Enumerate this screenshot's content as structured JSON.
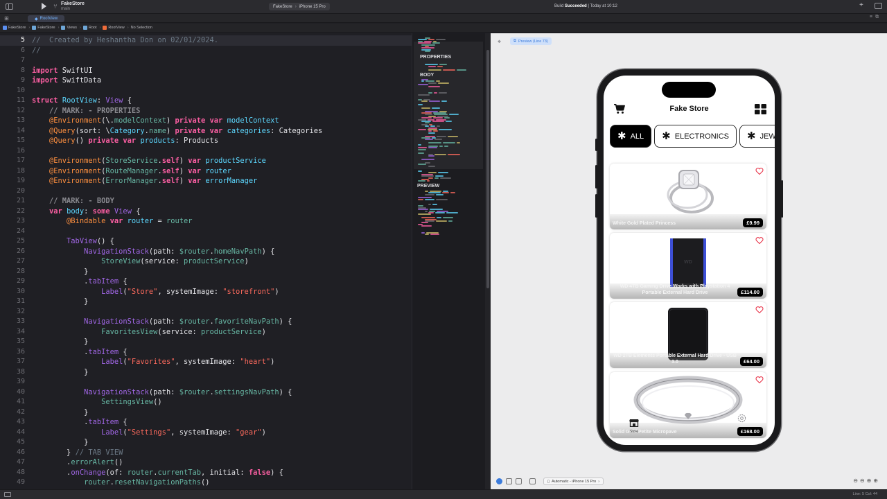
{
  "titlebar": {
    "project": "FakeStore",
    "branch": "main",
    "scheme_project": "FakeStore",
    "scheme_device": "iPhone 15 Pro",
    "build_prefix": "Build",
    "build_state": "Succeeded",
    "build_time": "| Today at 10:12"
  },
  "tab": {
    "label": "RootView"
  },
  "breadcrumbs": [
    "FakeStore",
    "FakeStore",
    "Views",
    "Root",
    "RootView",
    "No Selection"
  ],
  "minimap": {
    "properties": "PROPERTIES",
    "body": "BODY",
    "preview": "PREVIEW"
  },
  "editor": {
    "lines": [
      {
        "n": "5",
        "html": "<span class=\"c\">//  Created by Heshantha Don on 02/01/2024.</span>"
      },
      {
        "n": "6",
        "html": "<span class=\"c\">//</span>"
      },
      {
        "n": "7",
        "html": ""
      },
      {
        "n": "8",
        "html": "<span class=\"k\">import</span> SwiftUI"
      },
      {
        "n": "9",
        "html": "<span class=\"k\">import</span> SwiftData"
      },
      {
        "n": "10",
        "html": ""
      },
      {
        "n": "11",
        "html": "<span class=\"k\">struct</span> <span class=\"t\">RootView</span>: <span class=\"fm\">View</span> {"
      },
      {
        "n": "12",
        "html": "    <span class=\"cm\">// MARK: - PROPERTIES</span>"
      },
      {
        "n": "13",
        "html": "    <span class=\"at\">@Environment</span>(\\.<span class=\"f\">modelContext</span>) <span class=\"k\">private</span> <span class=\"k\">var</span> <span class=\"t\">modelContext</span>"
      },
      {
        "n": "14",
        "html": "    <span class=\"at\">@Query</span>(sort: \\<span class=\"t\">Category</span>.<span class=\"f\">name</span>) <span class=\"k\">private</span> <span class=\"k\">var</span> <span class=\"t\">categories</span>: Categories"
      },
      {
        "n": "15",
        "html": "    <span class=\"at\">@Query</span>() <span class=\"k\">private</span> <span class=\"k\">var</span> <span class=\"t\">products</span>: Products"
      },
      {
        "n": "16",
        "html": ""
      },
      {
        "n": "17",
        "html": "    <span class=\"at\">@Environment</span>(<span class=\"f\">StoreService</span>.<span class=\"k\">self</span>) <span class=\"k\">var</span> <span class=\"t\">productService</span>"
      },
      {
        "n": "18",
        "html": "    <span class=\"at\">@Environment</span>(<span class=\"f\">RouteManager</span>.<span class=\"k\">self</span>) <span class=\"k\">var</span> <span class=\"t\">router</span>"
      },
      {
        "n": "19",
        "html": "    <span class=\"at\">@Environment</span>(<span class=\"f\">ErrorManager</span>.<span class=\"k\">self</span>) <span class=\"k\">var</span> <span class=\"t\">errorManager</span>"
      },
      {
        "n": "20",
        "html": ""
      },
      {
        "n": "21",
        "html": "    <span class=\"cm\">// MARK: - BODY</span>"
      },
      {
        "n": "22",
        "html": "    <span class=\"k\">var</span> <span class=\"t\">body</span>: <span class=\"k\">some</span> <span class=\"fm\">View</span> {"
      },
      {
        "n": "23",
        "html": "        <span class=\"at\">@Bindable</span> <span class=\"k\">var</span> <span class=\"t\">router</span> = <span class=\"f\">router</span>"
      },
      {
        "n": "24",
        "html": ""
      },
      {
        "n": "25",
        "html": "        <span class=\"fm\">TabView</span>() {"
      },
      {
        "n": "26",
        "html": "            <span class=\"fm\">NavigationStack</span>(path: <span class=\"f\">$router</span>.<span class=\"f\">homeNavPath</span>) {"
      },
      {
        "n": "27",
        "html": "                <span class=\"f\">StoreView</span>(service: <span class=\"f\">productService</span>)"
      },
      {
        "n": "28",
        "html": "            }"
      },
      {
        "n": "29",
        "html": "            .<span class=\"fm\">tabItem</span> {"
      },
      {
        "n": "30",
        "html": "                <span class=\"fm\">Label</span>(<span class=\"s\">\"Store\"</span>, systemImage: <span class=\"s\">\"storefront\"</span>)"
      },
      {
        "n": "31",
        "html": "            }"
      },
      {
        "n": "32",
        "html": ""
      },
      {
        "n": "33",
        "html": "            <span class=\"fm\">NavigationStack</span>(path: <span class=\"f\">$router</span>.<span class=\"f\">favoriteNavPath</span>) {"
      },
      {
        "n": "34",
        "html": "                <span class=\"f\">FavoritesView</span>(service: <span class=\"f\">productService</span>)"
      },
      {
        "n": "35",
        "html": "            }"
      },
      {
        "n": "36",
        "html": "            .<span class=\"fm\">tabItem</span> {"
      },
      {
        "n": "37",
        "html": "                <span class=\"fm\">Label</span>(<span class=\"s\">\"Favorites\"</span>, systemImage: <span class=\"s\">\"heart\"</span>)"
      },
      {
        "n": "38",
        "html": "            }"
      },
      {
        "n": "39",
        "html": ""
      },
      {
        "n": "40",
        "html": "            <span class=\"fm\">NavigationStack</span>(path: <span class=\"f\">$router</span>.<span class=\"f\">settingsNavPath</span>) {"
      },
      {
        "n": "41",
        "html": "                <span class=\"f\">SettingsView</span>()"
      },
      {
        "n": "42",
        "html": "            }"
      },
      {
        "n": "43",
        "html": "            .<span class=\"fm\">tabItem</span> {"
      },
      {
        "n": "44",
        "html": "                <span class=\"fm\">Label</span>(<span class=\"s\">\"Settings\"</span>, systemImage: <span class=\"s\">\"gear\"</span>)"
      },
      {
        "n": "45",
        "html": "            }"
      },
      {
        "n": "46",
        "html": "        } <span class=\"c\">// TAB VIEW</span>"
      },
      {
        "n": "47",
        "html": "        .<span class=\"f\">errorAlert</span>()"
      },
      {
        "n": "48",
        "html": "        .<span class=\"fm\">onChange</span>(of: <span class=\"f\">router</span>.<span class=\"f\">currentTab</span>, initial: <span class=\"k\">false</span>) {"
      },
      {
        "n": "49",
        "html": "            <span class=\"f\">router</span>.<span class=\"f\">resetNavigationPaths</span>()"
      }
    ]
  },
  "preview": {
    "chip_label": "Preview (Line 73)",
    "app_title": "Fake Store",
    "categories": [
      "ALL",
      "ELECTRONICS",
      "JEWELERY"
    ],
    "products": [
      {
        "name": "White Gold Plated Princess",
        "price": "£9.99"
      },
      {
        "name": "WD 4TB Gaming Drive Works with Playstation 4 Portable External Hard Drive",
        "price": "£114.00"
      },
      {
        "name": "WD 2TB Elements Portable External Hard Drive - USB 3.0",
        "price": "£64.00"
      },
      {
        "name": "Solid Gold Petite Micropave",
        "price": "£168.00"
      }
    ],
    "tab_store": "Store",
    "device_picker": "Automatic - iPhone 15 Pro"
  },
  "status": {
    "position": "Line: 5  Col: 44"
  },
  "colors": {
    "accent": "#3b7bdb",
    "keyword": "#fc5fa3",
    "type": "#5dd8ff",
    "string": "#fc6a5d",
    "heart": "#e8354a"
  }
}
